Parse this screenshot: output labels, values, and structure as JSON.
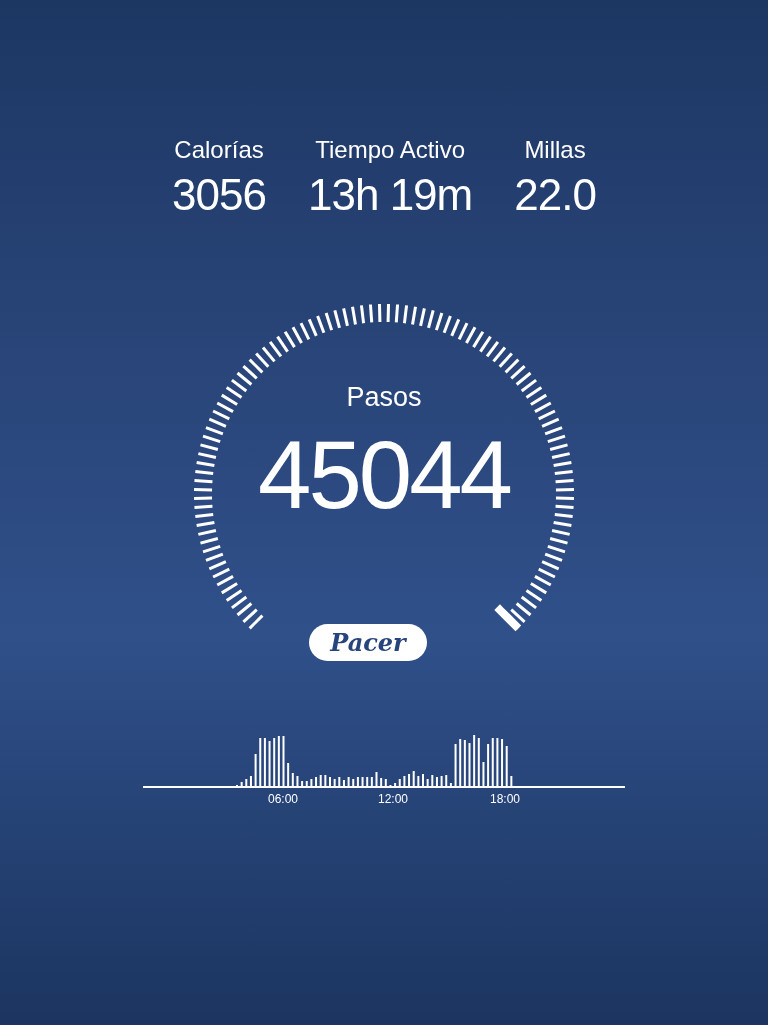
{
  "stats": [
    {
      "label": "Calorías",
      "value": "3056"
    },
    {
      "label": "Tiempo Activo",
      "value": "13h 19m"
    },
    {
      "label": "Millas",
      "value": "22.0"
    }
  ],
  "steps": {
    "label": "Pasos",
    "value": "45044"
  },
  "logo": "Pacer",
  "activity_chart": {
    "time_labels": [
      "06:00",
      "12:00",
      "18:00"
    ]
  }
}
